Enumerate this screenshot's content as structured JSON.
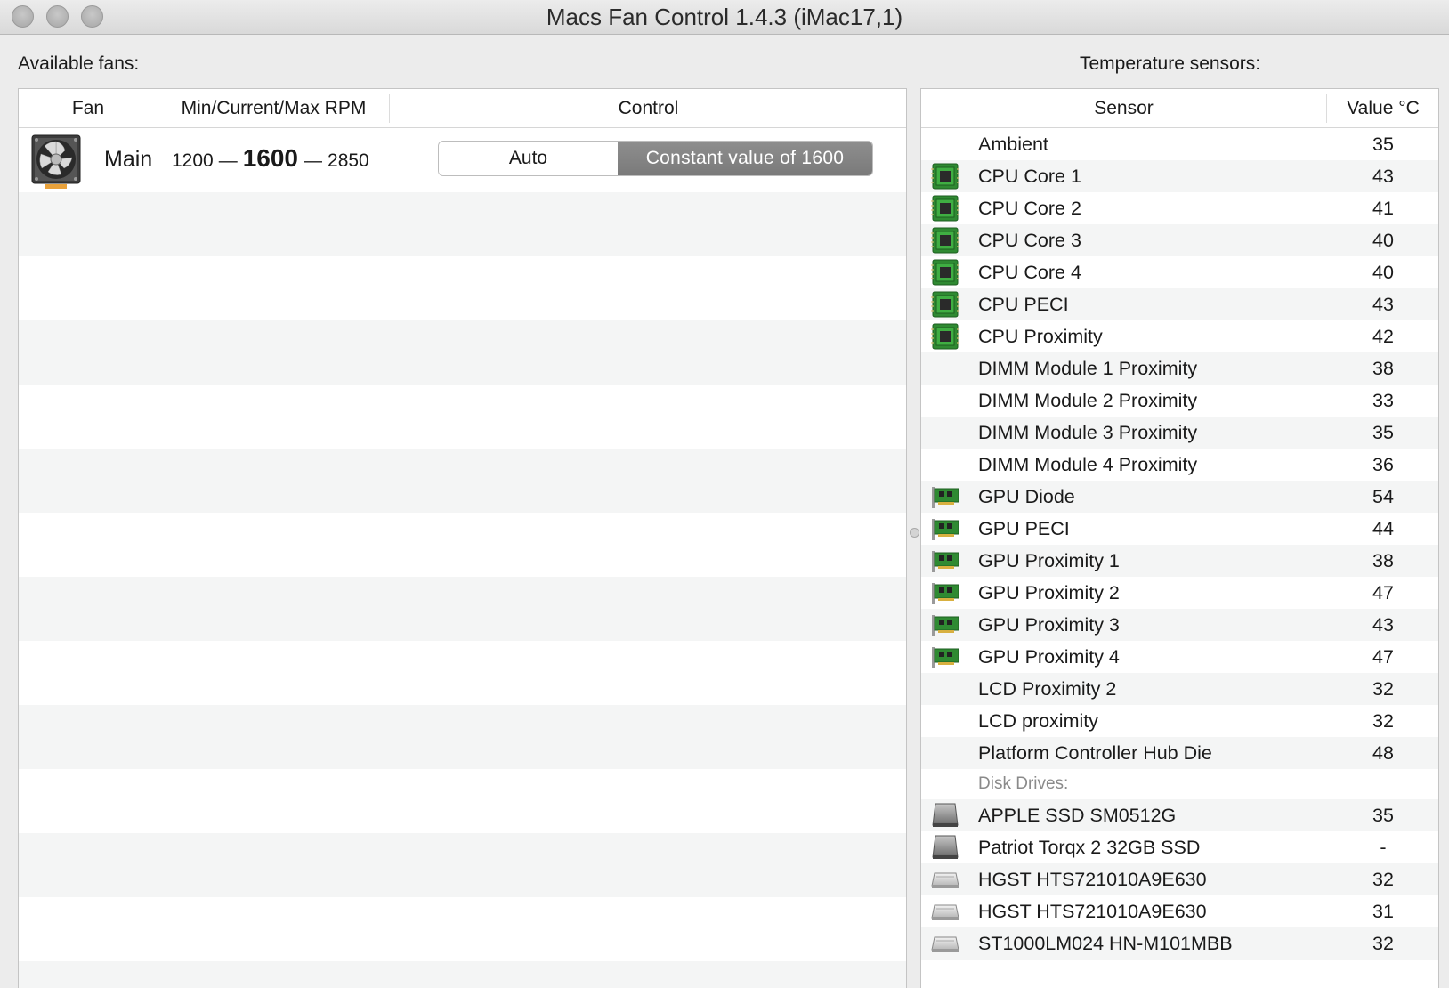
{
  "window": {
    "title": "Macs Fan Control 1.4.3 (iMac17,1)"
  },
  "fans": {
    "label": "Available fans:",
    "columns": {
      "fan": "Fan",
      "rpm": "Min/Current/Max RPM",
      "control": "Control"
    },
    "items": [
      {
        "name": "Main",
        "min": "1200",
        "current": "1600",
        "max": "2850",
        "dash": "—",
        "control_auto": "Auto",
        "control_constant": "Constant value of 1600",
        "selected_mode": "constant"
      }
    ]
  },
  "sensors": {
    "label": "Temperature sensors:",
    "columns": {
      "sensor": "Sensor",
      "value": "Value °C"
    },
    "rows": [
      {
        "name": "Ambient",
        "value": "35",
        "icon": "none"
      },
      {
        "name": "CPU Core 1",
        "value": "43",
        "icon": "cpu-chip-icon"
      },
      {
        "name": "CPU Core 2",
        "value": "41",
        "icon": "cpu-chip-icon"
      },
      {
        "name": "CPU Core 3",
        "value": "40",
        "icon": "cpu-chip-icon"
      },
      {
        "name": "CPU Core 4",
        "value": "40",
        "icon": "cpu-chip-icon"
      },
      {
        "name": "CPU PECI",
        "value": "43",
        "icon": "cpu-chip-icon"
      },
      {
        "name": "CPU Proximity",
        "value": "42",
        "icon": "cpu-chip-icon"
      },
      {
        "name": "DIMM Module 1 Proximity",
        "value": "38",
        "icon": "none"
      },
      {
        "name": "DIMM Module 2 Proximity",
        "value": "33",
        "icon": "none"
      },
      {
        "name": "DIMM Module 3 Proximity",
        "value": "35",
        "icon": "none"
      },
      {
        "name": "DIMM Module 4 Proximity",
        "value": "36",
        "icon": "none"
      },
      {
        "name": "GPU Diode",
        "value": "54",
        "icon": "gpu-card-icon"
      },
      {
        "name": "GPU PECI",
        "value": "44",
        "icon": "gpu-card-icon"
      },
      {
        "name": "GPU Proximity 1",
        "value": "38",
        "icon": "gpu-card-icon"
      },
      {
        "name": "GPU Proximity 2",
        "value": "47",
        "icon": "gpu-card-icon"
      },
      {
        "name": "GPU Proximity 3",
        "value": "43",
        "icon": "gpu-card-icon"
      },
      {
        "name": "GPU Proximity 4",
        "value": "47",
        "icon": "gpu-card-icon"
      },
      {
        "name": "LCD Proximity 2",
        "value": "32",
        "icon": "none"
      },
      {
        "name": "LCD proximity",
        "value": "32",
        "icon": "none"
      },
      {
        "name": "Platform Controller Hub Die",
        "value": "48",
        "icon": "none"
      }
    ],
    "disk_group_label": "Disk Drives:",
    "disks": [
      {
        "name": "APPLE SSD SM0512G",
        "value": "35",
        "icon": "ssd-drive-icon"
      },
      {
        "name": "Patriot Torqx 2 32GB SSD",
        "value": "-",
        "icon": "ssd-drive-icon"
      },
      {
        "name": "HGST HTS721010A9E630",
        "value": "32",
        "icon": "hdd-drive-icon"
      },
      {
        "name": "HGST HTS721010A9E630",
        "value": "31",
        "icon": "hdd-drive-icon"
      },
      {
        "name": "ST1000LM024 HN-M101MBB",
        "value": "32",
        "icon": "hdd-drive-icon"
      }
    ]
  },
  "colors": {
    "selected_segment": "#7f7f7f",
    "chip_green": "#3a9a3a",
    "alt_row": "#f4f5f5"
  }
}
